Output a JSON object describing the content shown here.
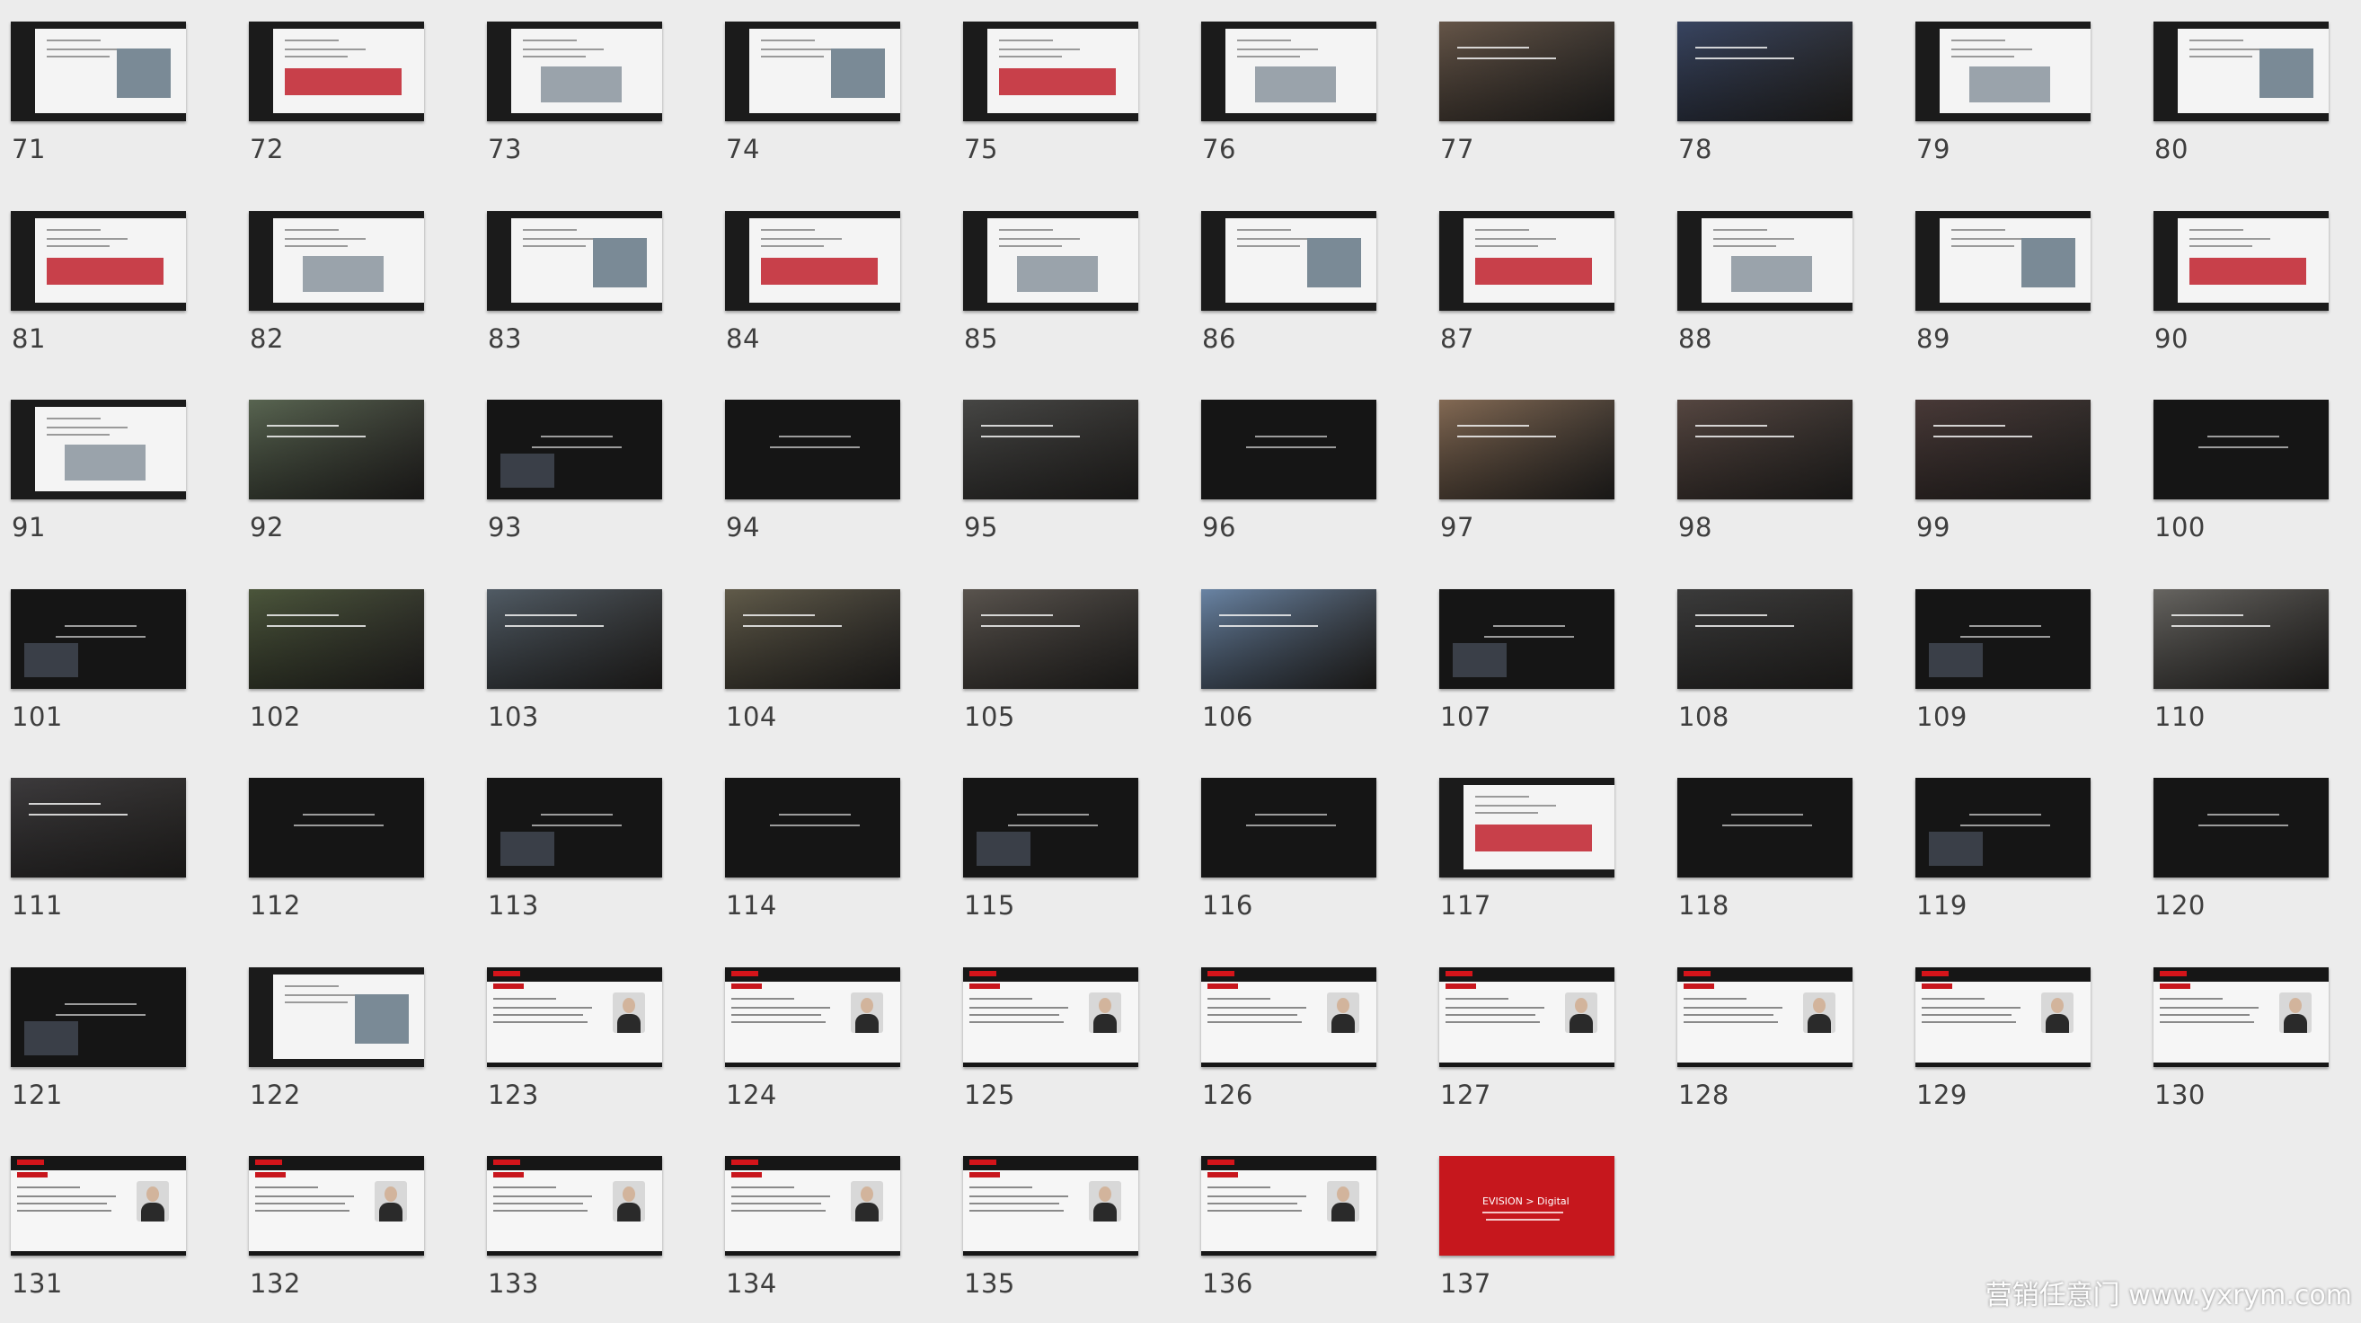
{
  "slides": [
    {
      "number": "71",
      "style": "white"
    },
    {
      "number": "72",
      "style": "white"
    },
    {
      "number": "73",
      "style": "white"
    },
    {
      "number": "74",
      "style": "white"
    },
    {
      "number": "75",
      "style": "white"
    },
    {
      "number": "76",
      "style": "white"
    },
    {
      "number": "77",
      "style": "photo",
      "color": "#6b5a4c"
    },
    {
      "number": "78",
      "style": "photo",
      "color": "#3b4866"
    },
    {
      "number": "79",
      "style": "white"
    },
    {
      "number": "80",
      "style": "white"
    },
    {
      "number": "81",
      "style": "white"
    },
    {
      "number": "82",
      "style": "white"
    },
    {
      "number": "83",
      "style": "white"
    },
    {
      "number": "84",
      "style": "white"
    },
    {
      "number": "85",
      "style": "white"
    },
    {
      "number": "86",
      "style": "white"
    },
    {
      "number": "87",
      "style": "white"
    },
    {
      "number": "88",
      "style": "white"
    },
    {
      "number": "89",
      "style": "white"
    },
    {
      "number": "90",
      "style": "white"
    },
    {
      "number": "91",
      "style": "white"
    },
    {
      "number": "92",
      "style": "photo",
      "color": "#5d6a55"
    },
    {
      "number": "93",
      "style": "dark"
    },
    {
      "number": "94",
      "style": "dark"
    },
    {
      "number": "95",
      "style": "photo",
      "color": "#4a4a48"
    },
    {
      "number": "96",
      "style": "dark"
    },
    {
      "number": "97",
      "style": "photo",
      "color": "#8a6f58"
    },
    {
      "number": "98",
      "style": "photo",
      "color": "#5a4a44"
    },
    {
      "number": "99",
      "style": "photo",
      "color": "#4c3c3a"
    },
    {
      "number": "100",
      "style": "dark"
    },
    {
      "number": "101",
      "style": "dark"
    },
    {
      "number": "102",
      "style": "photo",
      "color": "#4f5a3e"
    },
    {
      "number": "103",
      "style": "photo",
      "color": "#55606a"
    },
    {
      "number": "104",
      "style": "photo",
      "color": "#66604e"
    },
    {
      "number": "105",
      "style": "photo",
      "color": "#5e5852"
    },
    {
      "number": "106",
      "style": "photo",
      "color": "#6f8bad"
    },
    {
      "number": "107",
      "style": "dark"
    },
    {
      "number": "108",
      "style": "photo",
      "color": "#3e3e3e"
    },
    {
      "number": "109",
      "style": "dark"
    },
    {
      "number": "110",
      "style": "photo",
      "color": "#6c6a66"
    },
    {
      "number": "111",
      "style": "photo",
      "color": "#3f3d3f"
    },
    {
      "number": "112",
      "style": "dark"
    },
    {
      "number": "113",
      "style": "dark"
    },
    {
      "number": "114",
      "style": "dark"
    },
    {
      "number": "115",
      "style": "dark"
    },
    {
      "number": "116",
      "style": "dark"
    },
    {
      "number": "117",
      "style": "white"
    },
    {
      "number": "118",
      "style": "dark"
    },
    {
      "number": "119",
      "style": "dark"
    },
    {
      "number": "120",
      "style": "dark"
    },
    {
      "number": "121",
      "style": "dark"
    },
    {
      "number": "122",
      "style": "white"
    },
    {
      "number": "123",
      "style": "profile"
    },
    {
      "number": "124",
      "style": "profile"
    },
    {
      "number": "125",
      "style": "profile"
    },
    {
      "number": "126",
      "style": "profile"
    },
    {
      "number": "127",
      "style": "profile"
    },
    {
      "number": "128",
      "style": "profile"
    },
    {
      "number": "129",
      "style": "profile"
    },
    {
      "number": "130",
      "style": "profile"
    },
    {
      "number": "131",
      "style": "profile"
    },
    {
      "number": "132",
      "style": "profile"
    },
    {
      "number": "133",
      "style": "profile"
    },
    {
      "number": "134",
      "style": "profile"
    },
    {
      "number": "135",
      "style": "profile"
    },
    {
      "number": "136",
      "style": "profile"
    },
    {
      "number": "137",
      "style": "red",
      "logo": "EVISION > Digital"
    }
  ],
  "watermark": "营销任意门 www.yxrym.com"
}
